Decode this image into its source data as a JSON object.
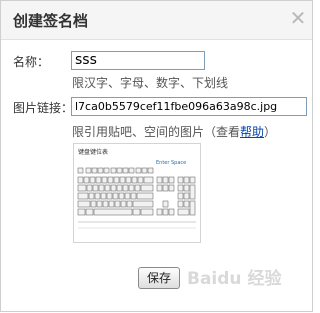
{
  "dialog": {
    "title": "创建签名档",
    "close_icon": "close-icon"
  },
  "form": {
    "name_label": "名称：",
    "name_value": "sss",
    "name_hint": "限汉字、字母、数字、下划线",
    "image_label": "图片链接：",
    "image_value": "l7ca0b5579cef11fbe096a63a98c.jpg",
    "image_hint_prefix": "限引用贴吧、空间的图片（查看",
    "image_hint_link": "帮助",
    "image_hint_suffix": "）"
  },
  "preview": {
    "caption": "键盘键位表",
    "side_text": "Enter  Space"
  },
  "buttons": {
    "save_label": "保存"
  },
  "watermark": {
    "text": "Baidu 经验"
  },
  "colors": {
    "input_border": "#7f9db9",
    "link": "#0645ad"
  }
}
